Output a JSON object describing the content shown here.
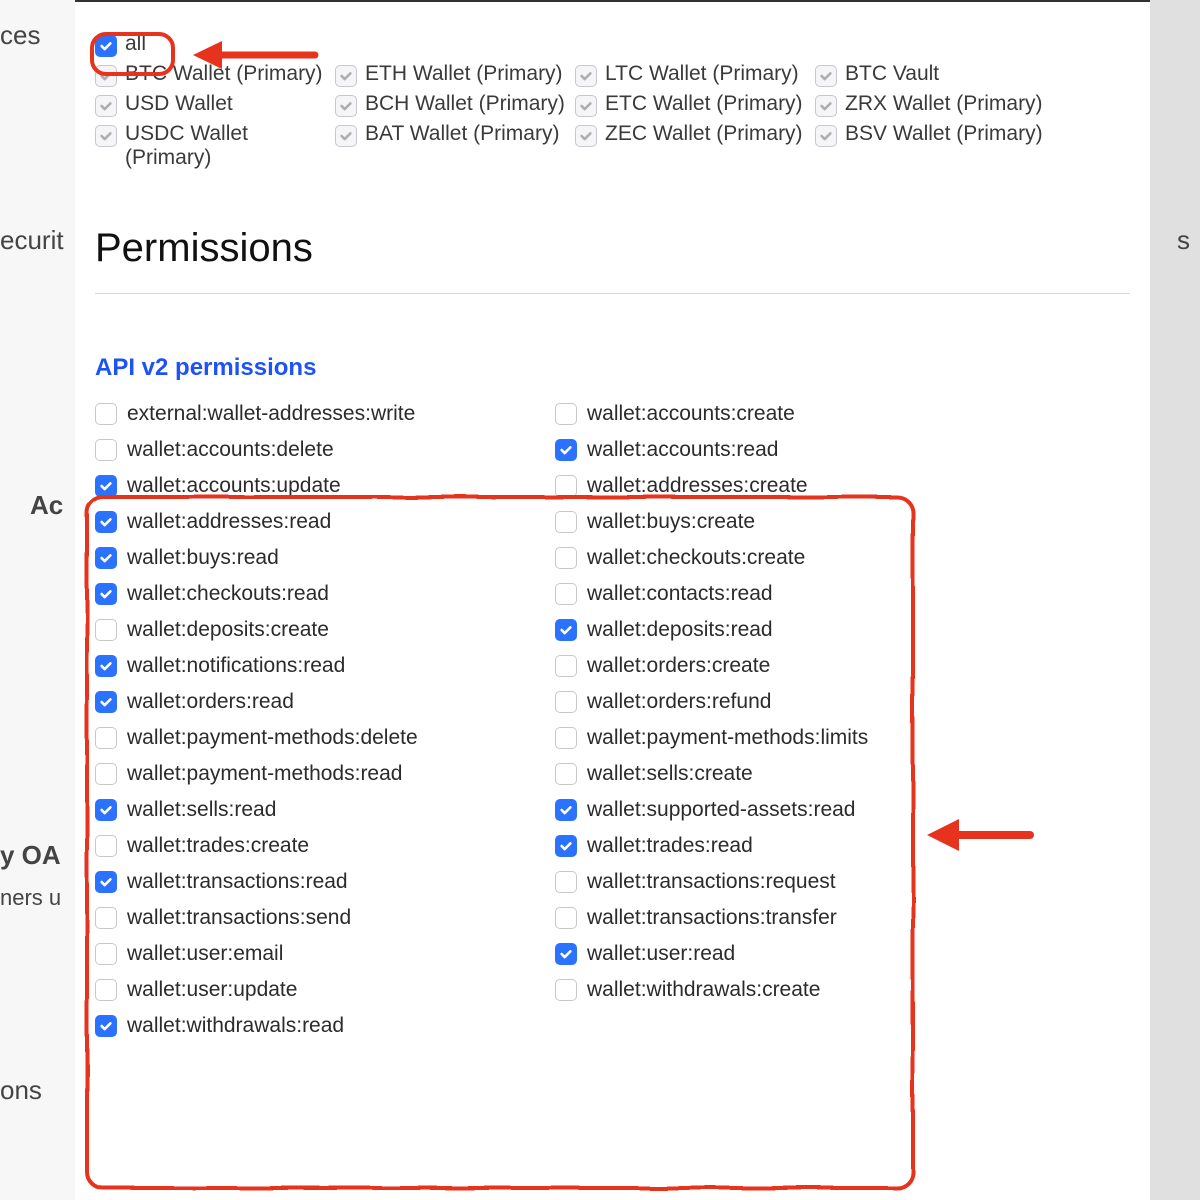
{
  "background": {
    "text1": "ces",
    "text2": "ecurit",
    "text3": "Ac",
    "text4": "y OA",
    "text5": "ners u",
    "text6": "ons",
    "text_right": "s"
  },
  "wallets": {
    "all": {
      "label": "all",
      "checked": true,
      "style": "blue"
    },
    "items": [
      {
        "label": "BTC Wallet (Primary)",
        "checked": true,
        "style": "grey"
      },
      {
        "label": "ETH Wallet (Primary)",
        "checked": true,
        "style": "grey"
      },
      {
        "label": "LTC Wallet (Primary)",
        "checked": true,
        "style": "grey"
      },
      {
        "label": "BTC Vault",
        "checked": true,
        "style": "grey"
      },
      {
        "label": "USD Wallet",
        "checked": true,
        "style": "grey"
      },
      {
        "label": "BCH Wallet (Primary)",
        "checked": true,
        "style": "grey"
      },
      {
        "label": "ETC Wallet (Primary)",
        "checked": true,
        "style": "grey"
      },
      {
        "label": "ZRX Wallet (Primary)",
        "checked": true,
        "style": "grey"
      },
      {
        "label": "USDC Wallet (Primary)",
        "checked": true,
        "style": "grey"
      },
      {
        "label": "BAT Wallet (Primary)",
        "checked": true,
        "style": "grey"
      },
      {
        "label": "ZEC Wallet (Primary)",
        "checked": true,
        "style": "grey"
      },
      {
        "label": "BSV Wallet (Primary)",
        "checked": true,
        "style": "grey"
      }
    ]
  },
  "headings": {
    "permissions": "Permissions",
    "api_v2": "API v2 permissions"
  },
  "permissions": [
    {
      "label": "external:wallet-addresses:write",
      "checked": false
    },
    {
      "label": "wallet:accounts:create",
      "checked": false
    },
    {
      "label": "wallet:accounts:delete",
      "checked": false
    },
    {
      "label": "wallet:accounts:read",
      "checked": true
    },
    {
      "label": "wallet:accounts:update",
      "checked": true
    },
    {
      "label": "wallet:addresses:create",
      "checked": false
    },
    {
      "label": "wallet:addresses:read",
      "checked": true
    },
    {
      "label": "wallet:buys:create",
      "checked": false
    },
    {
      "label": "wallet:buys:read",
      "checked": true
    },
    {
      "label": "wallet:checkouts:create",
      "checked": false
    },
    {
      "label": "wallet:checkouts:read",
      "checked": true
    },
    {
      "label": "wallet:contacts:read",
      "checked": false
    },
    {
      "label": "wallet:deposits:create",
      "checked": false
    },
    {
      "label": "wallet:deposits:read",
      "checked": true
    },
    {
      "label": "wallet:notifications:read",
      "checked": true
    },
    {
      "label": "wallet:orders:create",
      "checked": false
    },
    {
      "label": "wallet:orders:read",
      "checked": true
    },
    {
      "label": "wallet:orders:refund",
      "checked": false
    },
    {
      "label": "wallet:payment-methods:delete",
      "checked": false
    },
    {
      "label": "wallet:payment-methods:limits",
      "checked": false
    },
    {
      "label": "wallet:payment-methods:read",
      "checked": false
    },
    {
      "label": "wallet:sells:create",
      "checked": false
    },
    {
      "label": "wallet:sells:read",
      "checked": true
    },
    {
      "label": "wallet:supported-assets:read",
      "checked": true
    },
    {
      "label": "wallet:trades:create",
      "checked": false
    },
    {
      "label": "wallet:trades:read",
      "checked": true
    },
    {
      "label": "wallet:transactions:read",
      "checked": true
    },
    {
      "label": "wallet:transactions:request",
      "checked": false
    },
    {
      "label": "wallet:transactions:send",
      "checked": false
    },
    {
      "label": "wallet:transactions:transfer",
      "checked": false
    },
    {
      "label": "wallet:user:email",
      "checked": false
    },
    {
      "label": "wallet:user:read",
      "checked": true
    },
    {
      "label": "wallet:user:update",
      "checked": false
    },
    {
      "label": "wallet:withdrawals:create",
      "checked": false
    },
    {
      "label": "wallet:withdrawals:read",
      "checked": true
    }
  ]
}
